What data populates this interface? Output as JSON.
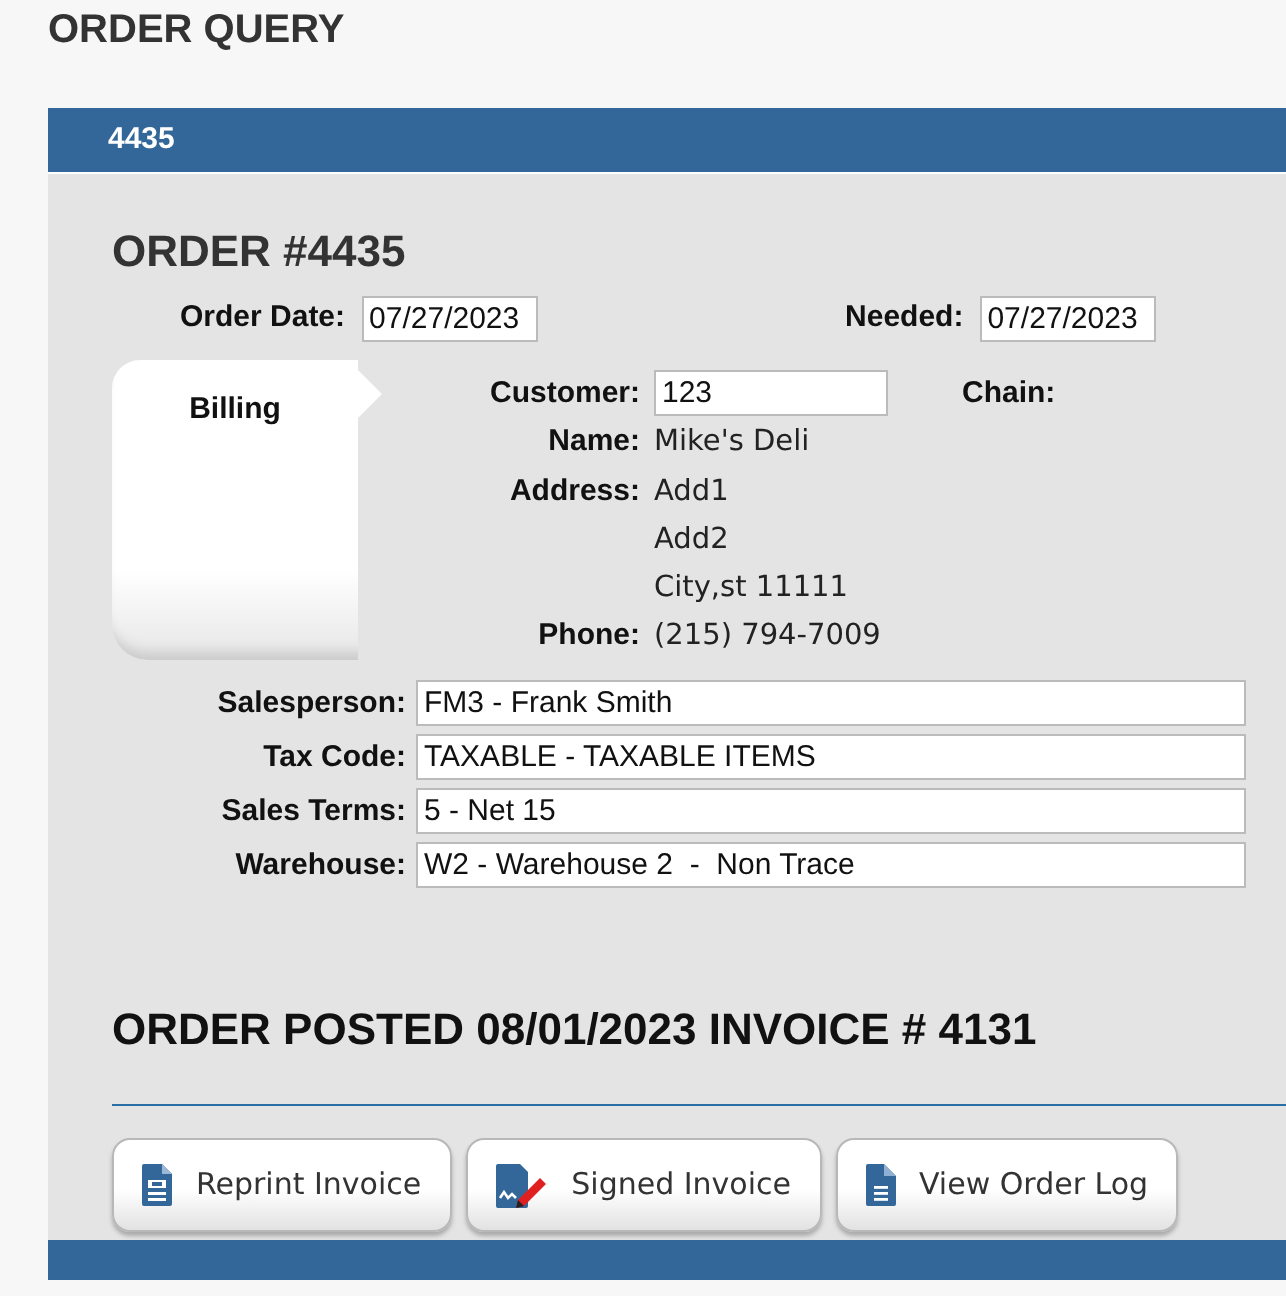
{
  "page_title": "ORDER QUERY",
  "header_bar": {
    "title": "4435"
  },
  "order_heading": "ORDER #4435",
  "dates": [
    {
      "label": "Order Date:",
      "value": "07/27/2023"
    },
    {
      "label": "Needed:",
      "value": "07/27/2023"
    }
  ],
  "billing_tab": {
    "label": "Billing"
  },
  "customer_fields": [
    {
      "label": "Customer:",
      "kind": "input",
      "value": "123"
    },
    {
      "label": "Name:",
      "kind": "text",
      "lines": [
        "Mike's Deli"
      ]
    },
    {
      "label": "Address:",
      "kind": "text",
      "lines": [
        "Add1",
        "Add2",
        "City,st 11111"
      ]
    },
    {
      "label": "Phone:",
      "kind": "text",
      "lines": [
        "(215) 794-7009"
      ]
    }
  ],
  "chain_label": "Chain:",
  "detail_fields": [
    {
      "label": "Salesperson:",
      "value": "FM3 - Frank Smith"
    },
    {
      "label": "Tax Code:",
      "value": "TAXABLE - TAXABLE ITEMS"
    },
    {
      "label": "Sales Terms:",
      "value": "5 - Net 15"
    },
    {
      "label": "Warehouse:",
      "value": "W2 - Warehouse 2  -  Non Trace"
    }
  ],
  "status": "ORDER POSTED 08/01/2023 INVOICE # 4131",
  "buttons": [
    {
      "label": "Reprint Invoice",
      "kind": "reprint"
    },
    {
      "label": "Signed Invoice",
      "kind": "signed"
    },
    {
      "label": "View Order Log",
      "kind": "log"
    }
  ]
}
